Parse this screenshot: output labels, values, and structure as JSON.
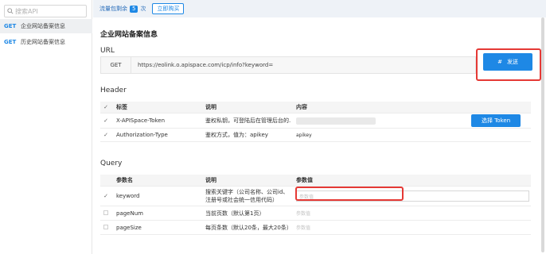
{
  "sidebar": {
    "search_placeholder": "搜索API",
    "items": [
      {
        "method": "GET",
        "label": "企业网站备案信息",
        "active": true
      },
      {
        "method": "GET",
        "label": "历史网站备案信息",
        "active": false
      }
    ]
  },
  "topbar": {
    "quota_prefix": "流量包剩余",
    "quota_count": "5",
    "quota_suffix": "次",
    "buy_label": "立即购买"
  },
  "page": {
    "title": "企业网站备案信息",
    "url_section": "URL",
    "header_section": "Header",
    "query_section": "Query"
  },
  "url": {
    "method": "GET",
    "value": "https://eolink.o.apispace.com/icp/info?keyword=",
    "send_icon": "#",
    "send_label": "发送"
  },
  "header_table": {
    "columns": [
      "标签",
      "说明",
      "内容"
    ],
    "rows": [
      {
        "checked": true,
        "name": "X-APISpace-Token",
        "desc": "鉴权私钥，可登陆后在管理后台的...",
        "value": "",
        "button": "选择 Token"
      },
      {
        "checked": true,
        "name": "Authorization-Type",
        "desc": "鉴权方式，值为：apikey",
        "value": "apikey",
        "button": ""
      }
    ]
  },
  "query_table": {
    "columns": [
      "参数名",
      "说明",
      "参数值"
    ],
    "rows": [
      {
        "checked": true,
        "name": "keyword",
        "desc": "搜索关键字（公司名称、公司id、注册号或社会统一信用代码）",
        "placeholder": "参数值"
      },
      {
        "checked": false,
        "name": "pageNum",
        "desc": "当前页数（默认第1页）",
        "placeholder": "参数值"
      },
      {
        "checked": false,
        "name": "pageSize",
        "desc": "每页条数（默认20条，最大20条）",
        "placeholder": "参数值"
      }
    ]
  },
  "colors": {
    "accent": "#1e88e5",
    "highlight": "#e53935"
  }
}
